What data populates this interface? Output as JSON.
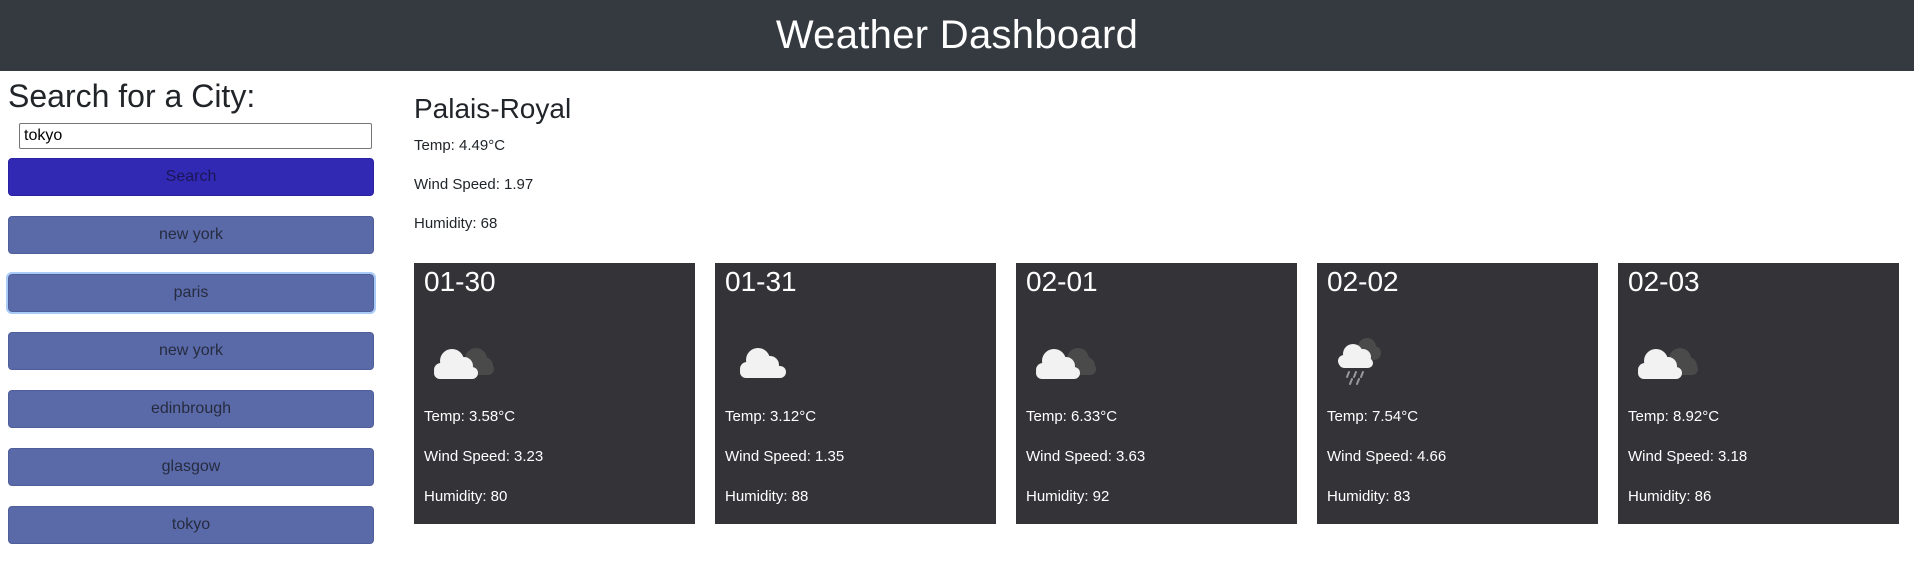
{
  "header": {
    "title": "Weather Dashboard"
  },
  "search": {
    "heading": "Search for a City:",
    "input_value": "tokyo",
    "button_label": "Search",
    "button_color": "#3128b4"
  },
  "history": [
    {
      "label": "new york"
    },
    {
      "label": "paris"
    },
    {
      "label": "new york"
    },
    {
      "label": "edinbrough"
    },
    {
      "label": "glasgow"
    },
    {
      "label": "tokyo"
    }
  ],
  "current": {
    "city": "Palais-Royal",
    "temp": "Temp: 4.49°C",
    "wind": "Wind Speed: 1.97",
    "humidity": "Humidity: 68"
  },
  "forecast": [
    {
      "date": "01-30",
      "icon": "partly-cloudy-icon",
      "temp": "Temp: 3.58°C",
      "wind": "Wind Speed: 3.23",
      "humidity": "Humidity: 80"
    },
    {
      "date": "01-31",
      "icon": "cloud-icon",
      "temp": "Temp: 3.12°C",
      "wind": "Wind Speed: 1.35",
      "humidity": "Humidity: 88"
    },
    {
      "date": "02-01",
      "icon": "partly-cloudy-icon",
      "temp": "Temp: 6.33°C",
      "wind": "Wind Speed: 3.63",
      "humidity": "Humidity: 92"
    },
    {
      "date": "02-02",
      "icon": "rain-cloud-icon",
      "temp": "Temp: 7.54°C",
      "wind": "Wind Speed: 4.66",
      "humidity": "Humidity: 83"
    },
    {
      "date": "02-03",
      "icon": "partly-cloudy-icon",
      "temp": "Temp: 8.92°C",
      "wind": "Wind Speed: 3.18",
      "humidity": "Humidity: 86"
    }
  ],
  "colors": {
    "header_bg": "#343a40",
    "history_button": "#5a6aa8",
    "card_bg": "#343338"
  }
}
